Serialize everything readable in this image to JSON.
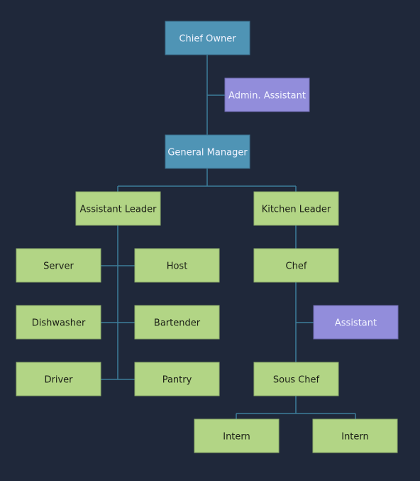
{
  "colors": {
    "background": "#1f283a",
    "executive": "#4f94b5",
    "assistant": "#928ddb",
    "staff": "#b2d585",
    "connector": "#3d7d9a"
  },
  "nodes": [
    {
      "id": "chief-owner",
      "label": "Chief Owner",
      "kind": "executive"
    },
    {
      "id": "admin-assistant",
      "label": "Admin. Assistant",
      "kind": "assistant"
    },
    {
      "id": "general-manager",
      "label": "General Manager",
      "kind": "executive"
    },
    {
      "id": "assistant-leader",
      "label": "Assistant Leader",
      "kind": "staff"
    },
    {
      "id": "kitchen-leader",
      "label": "Kitchen Leader",
      "kind": "staff"
    },
    {
      "id": "server",
      "label": "Server",
      "kind": "staff"
    },
    {
      "id": "host",
      "label": "Host",
      "kind": "staff"
    },
    {
      "id": "chef",
      "label": "Chef",
      "kind": "staff"
    },
    {
      "id": "dishwasher",
      "label": "Dishwasher",
      "kind": "staff"
    },
    {
      "id": "bartender",
      "label": "Bartender",
      "kind": "staff"
    },
    {
      "id": "assistant",
      "label": "Assistant",
      "kind": "assistant"
    },
    {
      "id": "driver",
      "label": "Driver",
      "kind": "staff"
    },
    {
      "id": "pantry",
      "label": "Pantry",
      "kind": "staff"
    },
    {
      "id": "sous-chef",
      "label": "Sous Chef",
      "kind": "staff"
    },
    {
      "id": "intern-1",
      "label": "Intern",
      "kind": "staff"
    },
    {
      "id": "intern-2",
      "label": "Intern",
      "kind": "staff"
    }
  ]
}
